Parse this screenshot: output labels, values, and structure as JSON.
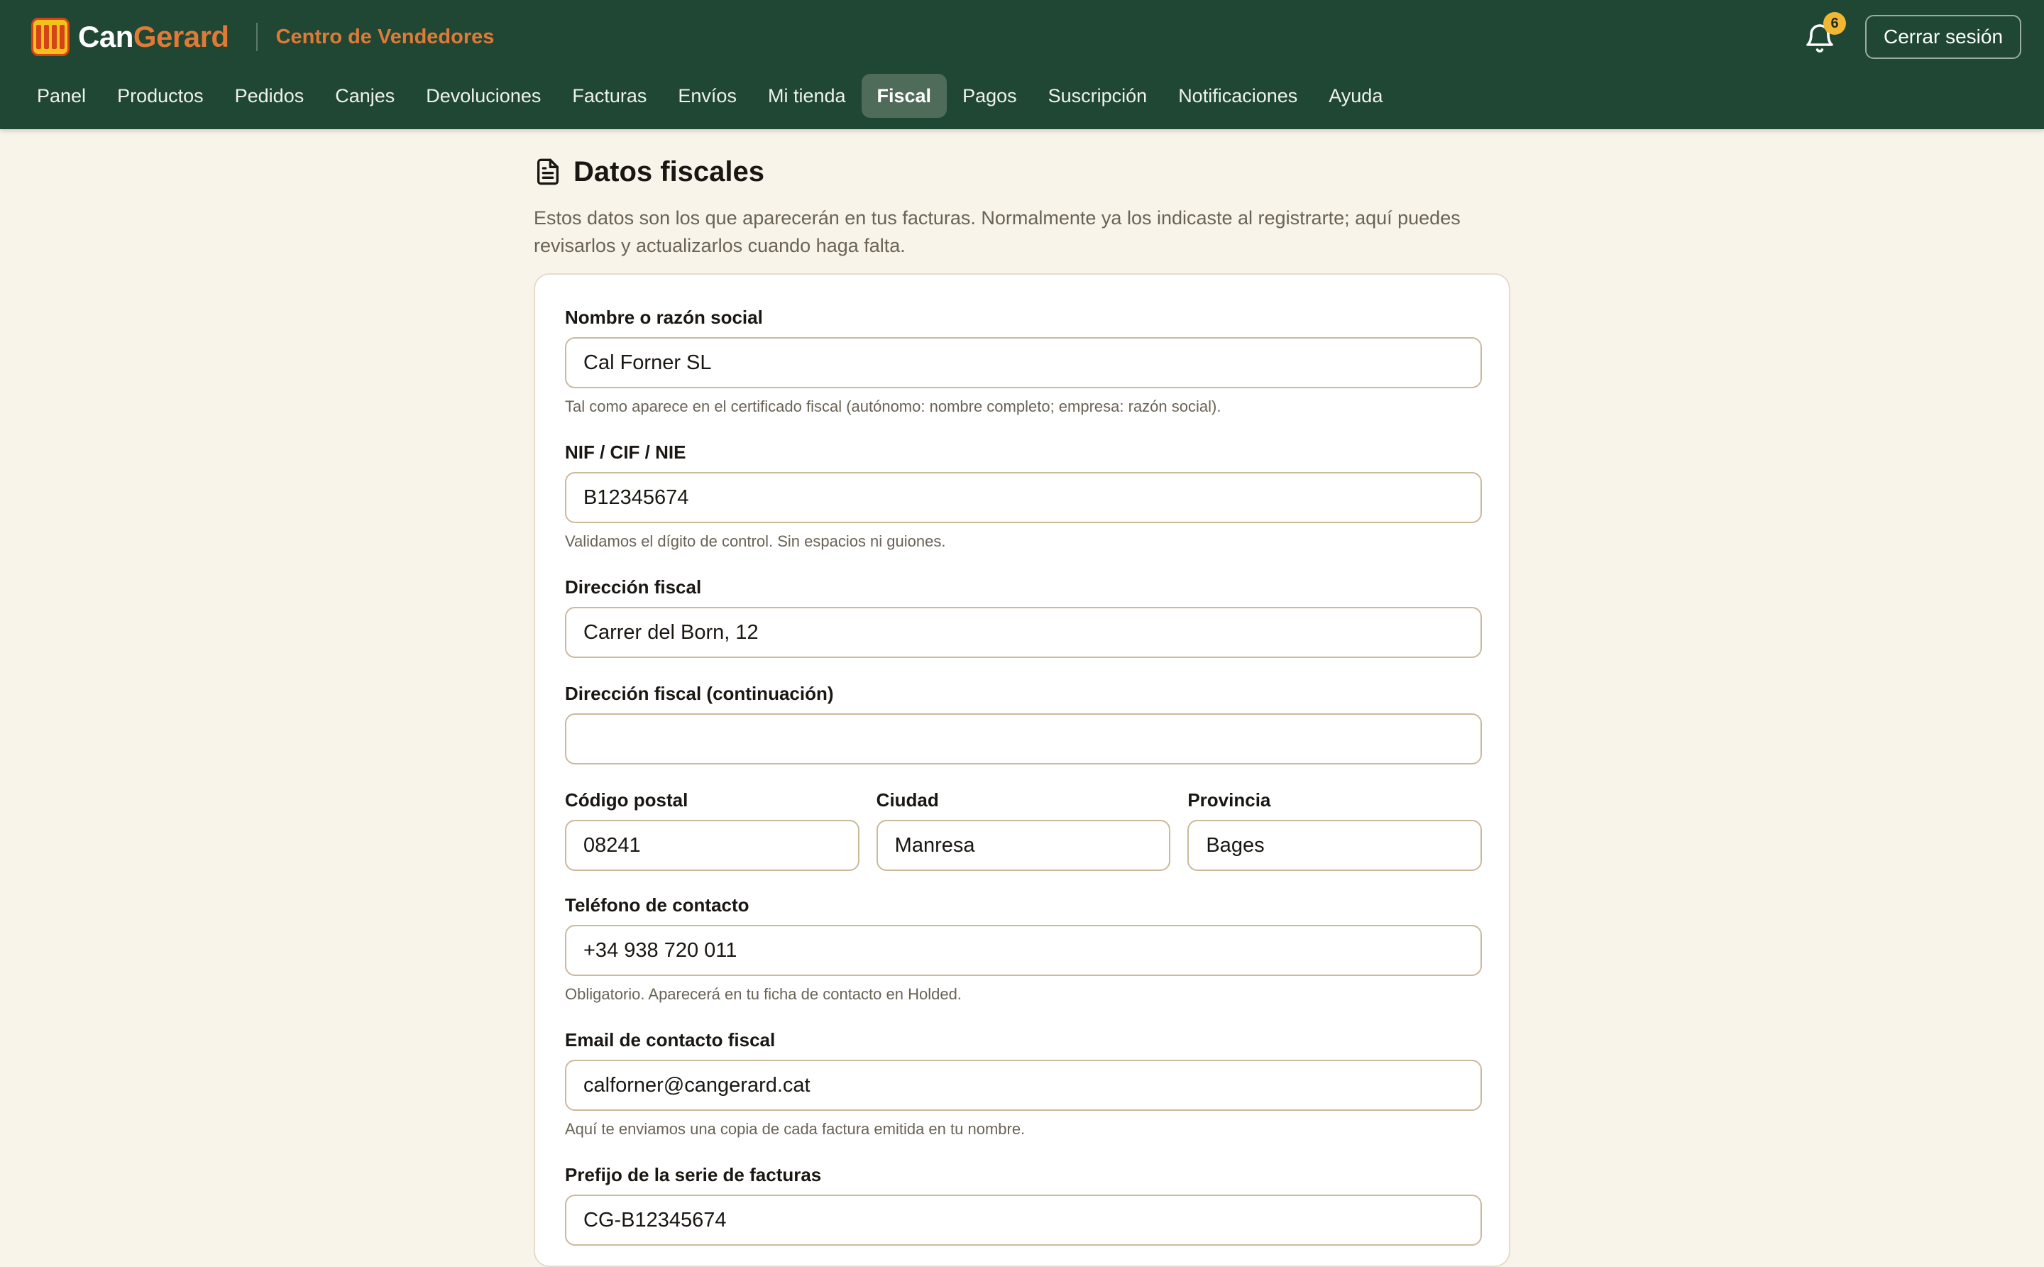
{
  "header": {
    "brand_can": "Can",
    "brand_gerard": "Gerard",
    "subtitle": "Centro de Vendedores",
    "notification_count": "6",
    "logout_label": "Cerrar sesión"
  },
  "nav": {
    "items": [
      {
        "label": "Panel"
      },
      {
        "label": "Productos"
      },
      {
        "label": "Pedidos"
      },
      {
        "label": "Canjes"
      },
      {
        "label": "Devoluciones"
      },
      {
        "label": "Facturas"
      },
      {
        "label": "Envíos"
      },
      {
        "label": "Mi tienda"
      },
      {
        "label": "Fiscal",
        "active": true
      },
      {
        "label": "Pagos"
      },
      {
        "label": "Suscripción"
      },
      {
        "label": "Notificaciones"
      },
      {
        "label": "Ayuda"
      }
    ]
  },
  "page": {
    "title": "Datos fiscales",
    "description": "Estos datos son los que aparecerán en tus facturas. Normalmente ya los indicaste al registrarte; aquí puedes revisarlos y actualizarlos cuando haga falta."
  },
  "form": {
    "name": {
      "label": "Nombre o razón social",
      "value": "Cal Forner SL",
      "hint": "Tal como aparece en el certificado fiscal (autónomo: nombre completo; empresa: razón social)."
    },
    "nif": {
      "label": "NIF / CIF / NIE",
      "value": "B12345674",
      "hint": "Validamos el dígito de control. Sin espacios ni guiones."
    },
    "address": {
      "label": "Dirección fiscal",
      "value": "Carrer del Born, 12"
    },
    "address2": {
      "label": "Dirección fiscal (continuación)",
      "value": ""
    },
    "postal_code": {
      "label": "Código postal",
      "value": "08241"
    },
    "city": {
      "label": "Ciudad",
      "value": "Manresa"
    },
    "province": {
      "label": "Provincia",
      "value": "Bages"
    },
    "phone": {
      "label": "Teléfono de contacto",
      "value": "+34 938 720 011",
      "hint": "Obligatorio. Aparecerá en tu ficha de contacto en Holded."
    },
    "email": {
      "label": "Email de contacto fiscal",
      "value": "calforner@cangerard.cat",
      "hint": "Aquí te enviamos una copia de cada factura emitida en tu nombre."
    },
    "invoice_prefix": {
      "label": "Prefijo de la serie de facturas",
      "value": "CG-B12345674"
    }
  },
  "colors": {
    "header_bg": "#1f4734",
    "accent_orange": "#e07a36",
    "page_bg": "#f8f4ea",
    "badge": "#f2b732"
  }
}
